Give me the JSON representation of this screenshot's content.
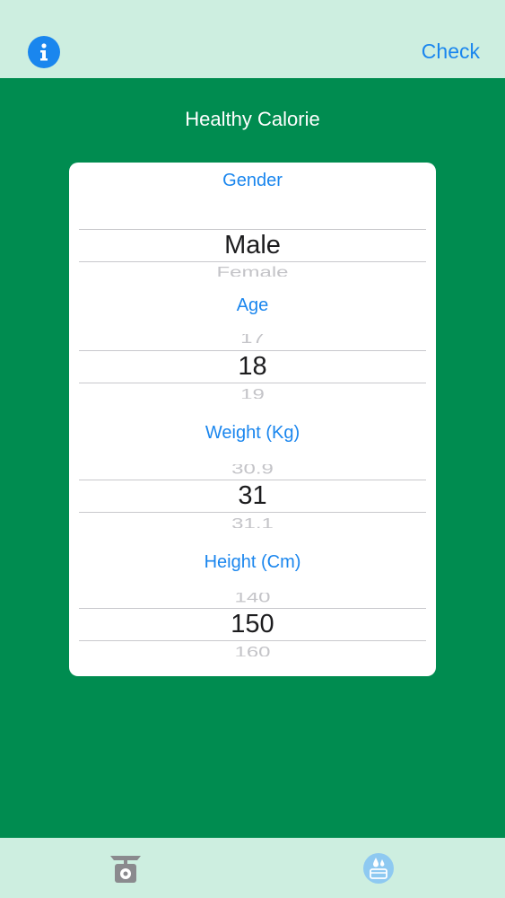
{
  "nav": {
    "check_label": "Check"
  },
  "app_title": "Healthy Calorie",
  "pickers": {
    "gender": {
      "label": "Gender",
      "prev": "",
      "selected": "Male",
      "next": "Female"
    },
    "age": {
      "label": "Age",
      "prev": "17",
      "selected": "18",
      "next": "19"
    },
    "weight": {
      "label": "Weight (Kg)",
      "prev": "30.9",
      "selected": "31",
      "next": "31.1"
    },
    "height": {
      "label": "Height (Cm)",
      "prev": "140",
      "selected": "150",
      "next": "160"
    }
  },
  "tabs": [
    {
      "icon": "kitchen-scale-icon"
    },
    {
      "icon": "water-bottle-icon"
    }
  ],
  "colors": {
    "accent": "#1a86ee",
    "background": "#008c50",
    "bars": "#cdeee0"
  }
}
